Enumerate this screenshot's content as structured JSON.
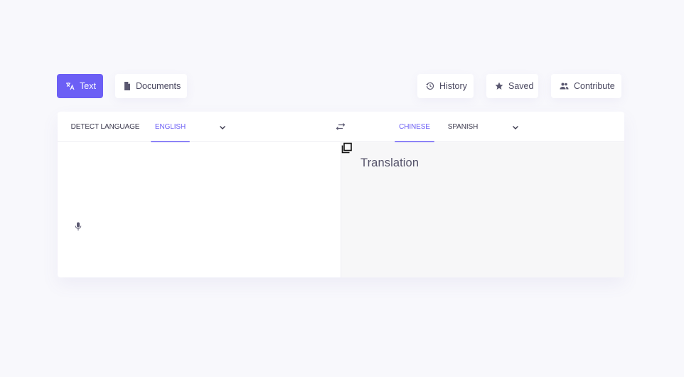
{
  "toolbar": {
    "left": [
      {
        "label": "Text",
        "icon": "translate-icon",
        "active": true
      },
      {
        "label": "Documents",
        "icon": "document-icon",
        "active": false
      }
    ],
    "right": [
      {
        "label": "History",
        "icon": "history-icon"
      },
      {
        "label": "Saved",
        "icon": "star-icon"
      },
      {
        "label": "Contribute",
        "icon": "people-icon"
      }
    ]
  },
  "source": {
    "languages": [
      {
        "label": "DETECT LANGUAGE",
        "active": false
      },
      {
        "label": "ENGLISH",
        "active": true
      }
    ],
    "text": ""
  },
  "target": {
    "languages": [
      {
        "label": "CHINESE",
        "active": true
      },
      {
        "label": "SPANISH",
        "active": false
      }
    ],
    "placeholder": "Translation"
  },
  "colors": {
    "accent": "#6c5ff5",
    "background": "#f8f8fc",
    "panel": "#ffffff",
    "target_panel": "#f7f7f8"
  }
}
